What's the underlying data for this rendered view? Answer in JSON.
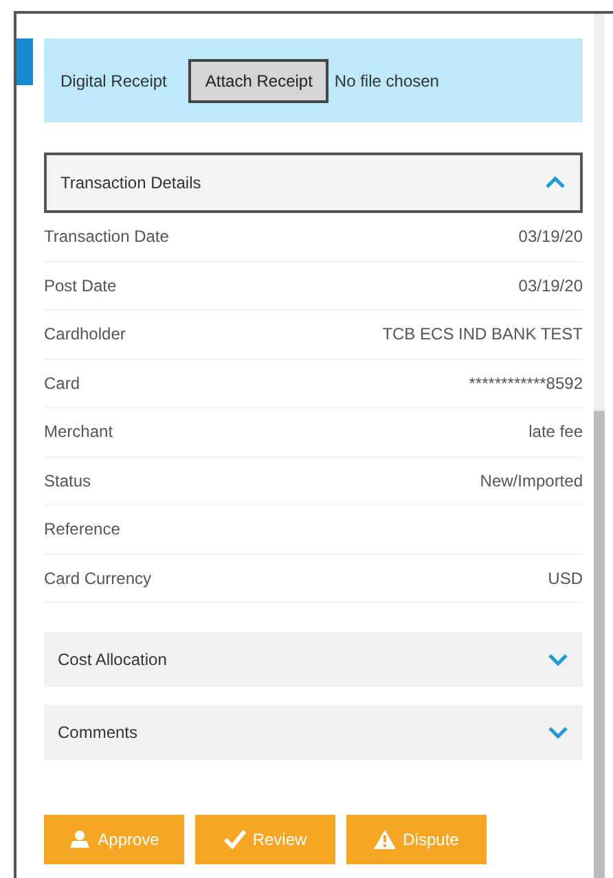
{
  "receipt": {
    "label": "Digital Receipt",
    "button": "Attach Receipt",
    "file_status": "No file chosen"
  },
  "sections": [
    {
      "title": "Transaction Details",
      "expanded": true,
      "rows": [
        {
          "label": "Transaction Date",
          "value": "03/19/20"
        },
        {
          "label": "Post Date",
          "value": "03/19/20"
        },
        {
          "label": "Cardholder",
          "value": "TCB ECS IND BANK TEST"
        },
        {
          "label": "Card",
          "value": "************8592"
        },
        {
          "label": "Merchant",
          "value": "late fee"
        },
        {
          "label": "Status",
          "value": "New/Imported"
        },
        {
          "label": "Reference",
          "value": ""
        },
        {
          "label": "Card Currency",
          "value": "USD"
        }
      ]
    },
    {
      "title": "Cost Allocation",
      "expanded": false
    },
    {
      "title": "Comments",
      "expanded": false
    }
  ],
  "actions": [
    {
      "label": "Approve",
      "kind": "approve"
    },
    {
      "label": "Review",
      "kind": "review"
    },
    {
      "label": "Dispute",
      "kind": "dispute"
    }
  ]
}
